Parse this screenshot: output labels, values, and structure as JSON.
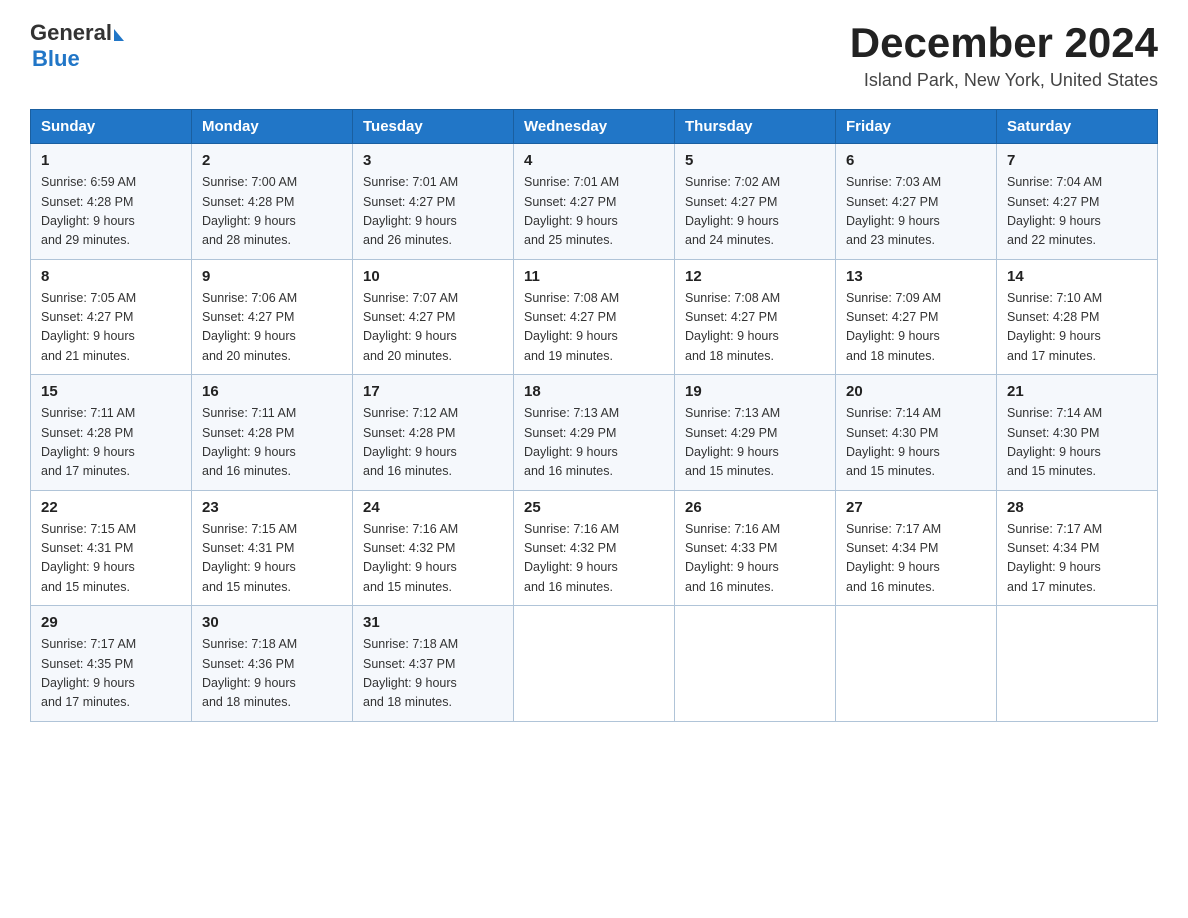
{
  "header": {
    "logo_general": "General",
    "logo_blue": "Blue",
    "month_title": "December 2024",
    "location": "Island Park, New York, United States"
  },
  "weekdays": [
    "Sunday",
    "Monday",
    "Tuesday",
    "Wednesday",
    "Thursday",
    "Friday",
    "Saturday"
  ],
  "weeks": [
    [
      {
        "day": "1",
        "sunrise": "6:59 AM",
        "sunset": "4:28 PM",
        "daylight": "9 hours and 29 minutes."
      },
      {
        "day": "2",
        "sunrise": "7:00 AM",
        "sunset": "4:28 PM",
        "daylight": "9 hours and 28 minutes."
      },
      {
        "day": "3",
        "sunrise": "7:01 AM",
        "sunset": "4:27 PM",
        "daylight": "9 hours and 26 minutes."
      },
      {
        "day": "4",
        "sunrise": "7:01 AM",
        "sunset": "4:27 PM",
        "daylight": "9 hours and 25 minutes."
      },
      {
        "day": "5",
        "sunrise": "7:02 AM",
        "sunset": "4:27 PM",
        "daylight": "9 hours and 24 minutes."
      },
      {
        "day": "6",
        "sunrise": "7:03 AM",
        "sunset": "4:27 PM",
        "daylight": "9 hours and 23 minutes."
      },
      {
        "day": "7",
        "sunrise": "7:04 AM",
        "sunset": "4:27 PM",
        "daylight": "9 hours and 22 minutes."
      }
    ],
    [
      {
        "day": "8",
        "sunrise": "7:05 AM",
        "sunset": "4:27 PM",
        "daylight": "9 hours and 21 minutes."
      },
      {
        "day": "9",
        "sunrise": "7:06 AM",
        "sunset": "4:27 PM",
        "daylight": "9 hours and 20 minutes."
      },
      {
        "day": "10",
        "sunrise": "7:07 AM",
        "sunset": "4:27 PM",
        "daylight": "9 hours and 20 minutes."
      },
      {
        "day": "11",
        "sunrise": "7:08 AM",
        "sunset": "4:27 PM",
        "daylight": "9 hours and 19 minutes."
      },
      {
        "day": "12",
        "sunrise": "7:08 AM",
        "sunset": "4:27 PM",
        "daylight": "9 hours and 18 minutes."
      },
      {
        "day": "13",
        "sunrise": "7:09 AM",
        "sunset": "4:27 PM",
        "daylight": "9 hours and 18 minutes."
      },
      {
        "day": "14",
        "sunrise": "7:10 AM",
        "sunset": "4:28 PM",
        "daylight": "9 hours and 17 minutes."
      }
    ],
    [
      {
        "day": "15",
        "sunrise": "7:11 AM",
        "sunset": "4:28 PM",
        "daylight": "9 hours and 17 minutes."
      },
      {
        "day": "16",
        "sunrise": "7:11 AM",
        "sunset": "4:28 PM",
        "daylight": "9 hours and 16 minutes."
      },
      {
        "day": "17",
        "sunrise": "7:12 AM",
        "sunset": "4:28 PM",
        "daylight": "9 hours and 16 minutes."
      },
      {
        "day": "18",
        "sunrise": "7:13 AM",
        "sunset": "4:29 PM",
        "daylight": "9 hours and 16 minutes."
      },
      {
        "day": "19",
        "sunrise": "7:13 AM",
        "sunset": "4:29 PM",
        "daylight": "9 hours and 15 minutes."
      },
      {
        "day": "20",
        "sunrise": "7:14 AM",
        "sunset": "4:30 PM",
        "daylight": "9 hours and 15 minutes."
      },
      {
        "day": "21",
        "sunrise": "7:14 AM",
        "sunset": "4:30 PM",
        "daylight": "9 hours and 15 minutes."
      }
    ],
    [
      {
        "day": "22",
        "sunrise": "7:15 AM",
        "sunset": "4:31 PM",
        "daylight": "9 hours and 15 minutes."
      },
      {
        "day": "23",
        "sunrise": "7:15 AM",
        "sunset": "4:31 PM",
        "daylight": "9 hours and 15 minutes."
      },
      {
        "day": "24",
        "sunrise": "7:16 AM",
        "sunset": "4:32 PM",
        "daylight": "9 hours and 15 minutes."
      },
      {
        "day": "25",
        "sunrise": "7:16 AM",
        "sunset": "4:32 PM",
        "daylight": "9 hours and 16 minutes."
      },
      {
        "day": "26",
        "sunrise": "7:16 AM",
        "sunset": "4:33 PM",
        "daylight": "9 hours and 16 minutes."
      },
      {
        "day": "27",
        "sunrise": "7:17 AM",
        "sunset": "4:34 PM",
        "daylight": "9 hours and 16 minutes."
      },
      {
        "day": "28",
        "sunrise": "7:17 AM",
        "sunset": "4:34 PM",
        "daylight": "9 hours and 17 minutes."
      }
    ],
    [
      {
        "day": "29",
        "sunrise": "7:17 AM",
        "sunset": "4:35 PM",
        "daylight": "9 hours and 17 minutes."
      },
      {
        "day": "30",
        "sunrise": "7:18 AM",
        "sunset": "4:36 PM",
        "daylight": "9 hours and 18 minutes."
      },
      {
        "day": "31",
        "sunrise": "7:18 AM",
        "sunset": "4:37 PM",
        "daylight": "9 hours and 18 minutes."
      },
      null,
      null,
      null,
      null
    ]
  ],
  "labels": {
    "sunrise": "Sunrise:",
    "sunset": "Sunset:",
    "daylight": "Daylight:"
  }
}
